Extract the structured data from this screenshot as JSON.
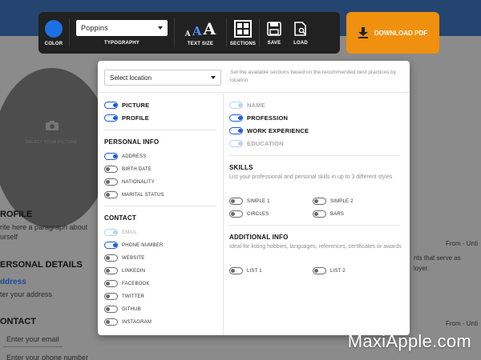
{
  "toolbar": {
    "color_label": "COLOR",
    "accent_color": "#1e6fe6",
    "font_value": "Poppins",
    "typography_label": "TYPOGRAPHY",
    "size_glyph": "A",
    "text_size_label": "TEXT SIZE",
    "sections_label": "SECTIONS",
    "save_label": "SAVE",
    "load_label": "LOAD",
    "download_label": "DOWNLOAD PDF",
    "download_color": "#f0900f"
  },
  "panel": {
    "location_select": "Select location",
    "location_help": "Set the available sections based on the recommended best practices by location",
    "left": {
      "top_options": [
        {
          "label": "PICTURE",
          "on": true
        },
        {
          "label": "PROFILE",
          "on": true
        }
      ],
      "personal_info": {
        "title": "PERSONAL INFO",
        "options": [
          {
            "label": "ADDRESS",
            "on": true
          },
          {
            "label": "BIRTH DATE",
            "on": false
          },
          {
            "label": "NATIONALITY",
            "on": false
          },
          {
            "label": "MARITAL STATUS",
            "on": false
          }
        ]
      },
      "contact": {
        "title": "CONTACT",
        "options": [
          {
            "label": "EMAIL",
            "on": true,
            "disabled": true
          },
          {
            "label": "PHONE NUMBER",
            "on": true
          },
          {
            "label": "WEBSITE",
            "on": false
          },
          {
            "label": "LINKEDIN",
            "on": false
          },
          {
            "label": "FACEBOOK",
            "on": false
          },
          {
            "label": "TWITTER",
            "on": false
          },
          {
            "label": "GITHUB",
            "on": false
          },
          {
            "label": "INSTAGRAM",
            "on": false
          }
        ]
      }
    },
    "right": {
      "top_options": [
        {
          "label": "NAME",
          "on": true,
          "disabled": true
        },
        {
          "label": "PROFESSION",
          "on": true
        },
        {
          "label": "WORK EXPERIENCE",
          "on": true
        },
        {
          "label": "EDUCATION",
          "on": true,
          "disabled": true
        }
      ],
      "skills": {
        "title": "SKILLS",
        "description": "List your professional and personal skills in up to 3 different styles",
        "options": [
          {
            "label": "SIMPLE 1",
            "on": false
          },
          {
            "label": "SIMPLE 2",
            "on": false
          },
          {
            "label": "CIRCLES",
            "on": false
          },
          {
            "label": "BARS",
            "on": false
          }
        ]
      },
      "additional": {
        "title": "ADDITIONAL INFO",
        "description": "Ideal for listing hobbies, languages, references, certificates or awards",
        "options": [
          {
            "label": "LIST 1",
            "on": false
          },
          {
            "label": "LIST 2",
            "on": false
          }
        ]
      }
    }
  },
  "background": {
    "photo_label": "SELECT YOUR PICTURE",
    "profile_heading": "ROFILE",
    "profile_text_1": "rite here a paragraph about",
    "profile_text_2": "urself",
    "personal_heading": "ERSONAL DETAILS",
    "address_label": "ddress",
    "address_placeholder": "ter your address",
    "contact_heading": "ONTACT",
    "email_placeholder": "Enter your email",
    "phone_placeholder": "Enter your phone number",
    "from_until_1": "From - Unti",
    "from_until_2": "From - Unti",
    "right_text_1": "nts that serve as",
    "right_text_2": "loyer."
  },
  "watermark": "MaxiApple.com"
}
